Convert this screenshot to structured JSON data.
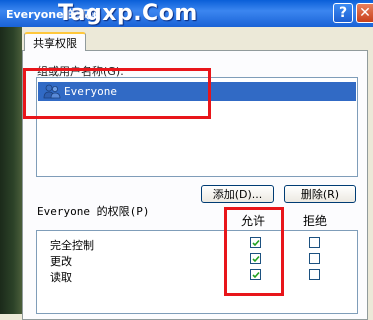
{
  "window": {
    "title": "Everyone 的权限",
    "watermark": "Tagxp.Com",
    "help_glyph": "?",
    "close_glyph": "✕"
  },
  "tabs": [
    {
      "label": "共享权限"
    }
  ],
  "users": {
    "label": "组或用户名称(G):",
    "items": [
      {
        "name": "Everyone",
        "selected": true,
        "icon": "users-icon"
      }
    ]
  },
  "buttons": {
    "add": "添加(D)...",
    "remove": "删除(R)"
  },
  "permissions": {
    "label": "Everyone 的权限(P)",
    "allow_header": "允许",
    "deny_header": "拒绝",
    "rows": [
      {
        "name": "完全控制",
        "allow": true,
        "deny": false
      },
      {
        "name": "更改",
        "allow": true,
        "deny": false
      },
      {
        "name": "读取",
        "allow": true,
        "deny": false
      }
    ]
  },
  "colors": {
    "selection": "#316ac5",
    "highlight_box": "#e8151a",
    "titlebar": "#0a5fd8"
  }
}
